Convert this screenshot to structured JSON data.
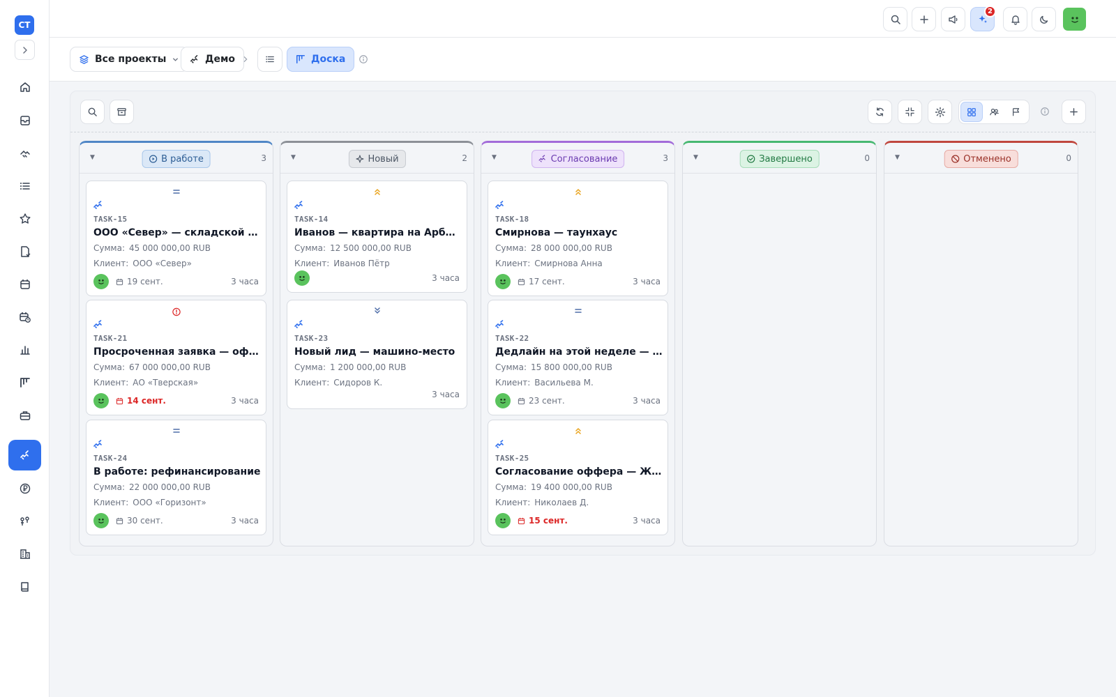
{
  "app": {
    "logo_text": "СТ"
  },
  "header": {
    "ai_badge_count": "2"
  },
  "breadcrumb": {
    "all_projects": "Все проекты",
    "project": "Демо",
    "board": "Доска"
  },
  "colors": {
    "accent": "#2f6fed",
    "overdue": "#dc2626",
    "in_progress": "#4f86c6",
    "new": "#8c9097",
    "approval": "#a26bd9",
    "done": "#47b871",
    "cancelled": "#c0473e"
  },
  "columns": [
    {
      "title": "В работе",
      "count": "3",
      "cards": [
        {
          "id": "TASK-15",
          "title": "ООО «Север» — складской ком...",
          "sum_label": "Сумма:",
          "sum": "45 000 000,00 RUB",
          "client_label": "Клиент:",
          "client": "ООО «Север»",
          "due": "19 сент.",
          "age": "3 часа",
          "priority": "medium"
        },
        {
          "id": "TASK-21",
          "title": "Просроченная заявка — офис н...",
          "sum_label": "Сумма:",
          "sum": "67 000 000,00 RUB",
          "client_label": "Клиент:",
          "client": "АО «Тверская»",
          "due": "14 сент.",
          "age": "3 часа",
          "priority": "urgent"
        },
        {
          "id": "TASK-24",
          "title": "В работе: рефинансирование",
          "sum_label": "Сумма:",
          "sum": "22 000 000,00 RUB",
          "client_label": "Клиент:",
          "client": "ООО «Горизонт»",
          "due": "30 сент.",
          "age": "3 часа",
          "priority": "medium"
        }
      ]
    },
    {
      "title": "Новый",
      "count": "2",
      "cards": [
        {
          "id": "TASK-14",
          "title": "Иванов — квартира на Арбате",
          "sum_label": "Сумма:",
          "sum": "12 500 000,00 RUB",
          "client_label": "Клиент:",
          "client": "Иванов Пётр",
          "age": "3 часа",
          "priority": "high"
        },
        {
          "id": "TASK-23",
          "title": "Новый лид — машино-место",
          "sum_label": "Сумма:",
          "sum": "1 200 000,00 RUB",
          "client_label": "Клиент:",
          "client": "Сидоров К.",
          "age": "3 часа",
          "priority": "low"
        }
      ]
    },
    {
      "title": "Согласование",
      "count": "3",
      "cards": [
        {
          "id": "TASK-18",
          "title": "Смирнова — таунхаус",
          "sum_label": "Сумма:",
          "sum": "28 000 000,00 RUB",
          "client_label": "Клиент:",
          "client": "Смирнова Анна",
          "due": "17 сент.",
          "age": "3 часа",
          "priority": "high"
        },
        {
          "id": "TASK-22",
          "title": "Дедлайн на этой неделе — дом ...",
          "sum_label": "Сумма:",
          "sum": "15 800 000,00 RUB",
          "client_label": "Клиент:",
          "client": "Васильева М.",
          "due": "23 сент.",
          "age": "3 часа",
          "priority": "medium"
        },
        {
          "id": "TASK-25",
          "title": "Согласование оффера — ЖК «Р...",
          "sum_label": "Сумма:",
          "sum": "19 400 000,00 RUB",
          "client_label": "Клиент:",
          "client": "Николаев Д.",
          "due": "15 сент.",
          "age": "3 часа",
          "priority": "high"
        }
      ]
    },
    {
      "title": "Завершено",
      "count": "0",
      "cards": []
    },
    {
      "title": "Отменено",
      "count": "0",
      "cards": []
    }
  ]
}
